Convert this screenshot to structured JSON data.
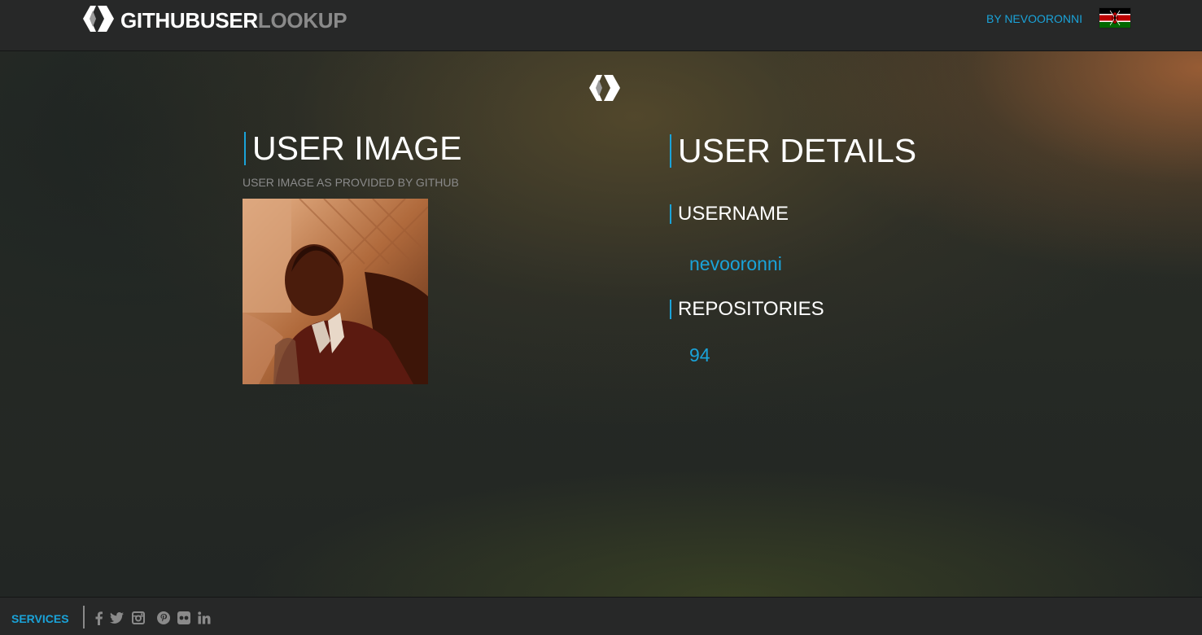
{
  "header": {
    "brand_primary": "GITHUBUSER",
    "brand_secondary": "LOOKUP",
    "byline": "BY NEVOORONNI",
    "flag_icon": "kenya-flag-icon"
  },
  "main": {
    "logo_icon": "diamond-chevron-logo-icon",
    "user_image": {
      "title": "USER IMAGE",
      "subtitle": "USER IMAGE AS PROVIDED BY GITHUB"
    },
    "user_details": {
      "title": "USER DETAILS",
      "username_label": "USERNAME",
      "username_value": "nevooronni",
      "repositories_label": "REPOSITORIES",
      "repositories_value": "94"
    }
  },
  "footer": {
    "services_label": "SERVICES",
    "social_icons": [
      "facebook-icon",
      "twitter-icon",
      "instagram-icon",
      "pinterest-icon",
      "flickr-icon",
      "linkedin-icon"
    ]
  },
  "colors": {
    "accent": "#1aa3d9",
    "header_bg": "#272828",
    "muted_text": "#8a8a8a"
  }
}
